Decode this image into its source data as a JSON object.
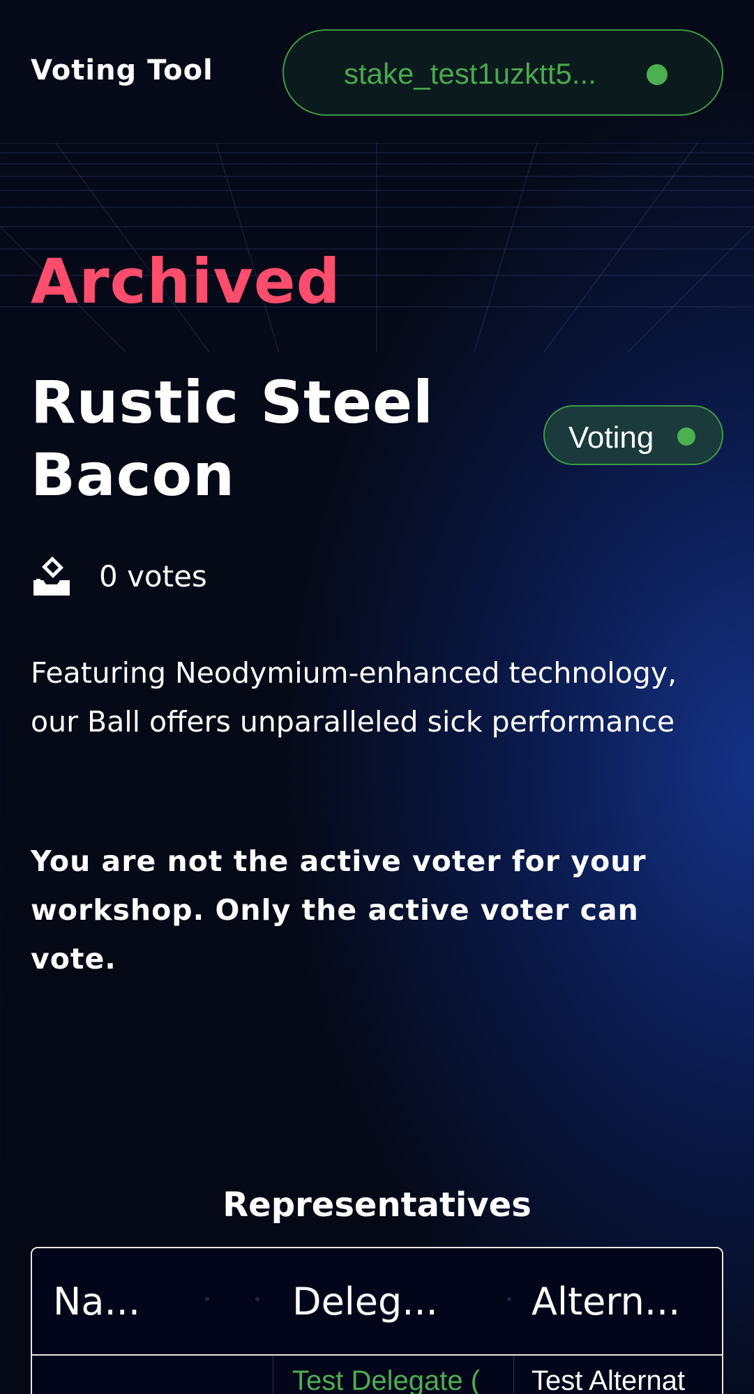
{
  "header": {
    "app_title": "Voting Tool",
    "wallet_address": "stake_test1uzktt5...",
    "wallet_status_color": "#4caf50"
  },
  "proposal": {
    "status": "Archived",
    "status_color": "#ff4d6d",
    "title": "Rustic Steel Bacon",
    "phase_badge": "Voting",
    "votes_icon": "ballot-box-icon",
    "votes_text": "0 votes",
    "description": "Featuring Neodymium-enhanced technology, our Ball offers unparalleled sick performance",
    "voter_notice": "You are not the active voter for your workshop. Only the active voter can vote."
  },
  "representatives": {
    "title": "Representatives",
    "columns": [
      "Na...",
      "Deleg...",
      "Altern..."
    ],
    "rows": [
      [
        "",
        "Test Delegate (",
        "Test Alternat"
      ]
    ],
    "link_color": "#4caf50"
  }
}
